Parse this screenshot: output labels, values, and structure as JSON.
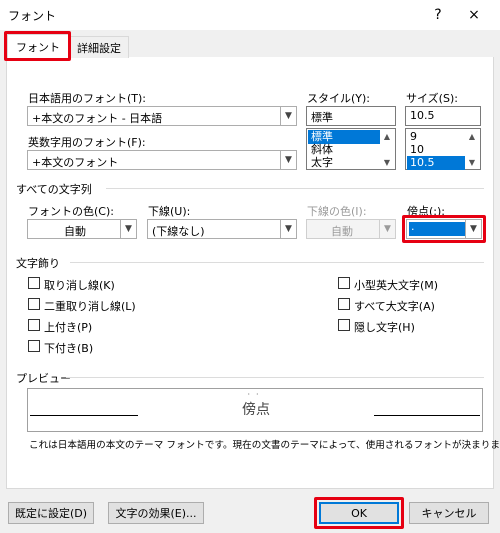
{
  "window": {
    "title": "フォント",
    "help": "?",
    "close": "×"
  },
  "tabs": [
    {
      "label": "フォント"
    },
    {
      "label": "詳細設定"
    }
  ],
  "font_section": {
    "ja_font_label": "日本語用のフォント(T):",
    "ja_font_value": "+本文のフォント - 日本語",
    "en_font_label": "英数字用のフォント(F):",
    "en_font_value": "+本文のフォント",
    "style_label": "スタイル(Y):",
    "style_value": "標準",
    "style_items": [
      "標準",
      "斜体",
      "太字"
    ],
    "size_label": "サイズ(S):",
    "size_value": "10.5",
    "size_items": [
      "9",
      "10",
      "10.5"
    ]
  },
  "all_text": {
    "section_title": "すべての文字列",
    "font_color_label": "フォントの色(C):",
    "font_color_value": "自動",
    "underline_label": "下線(U):",
    "underline_value": "(下線なし)",
    "underline_color_label": "下線の色(I):",
    "underline_color_value": "自動",
    "emphasis_label": "傍点(:):",
    "emphasis_value": "."
  },
  "effects": {
    "section_title": "文字飾り",
    "left": [
      "取り消し線(K)",
      "二重取り消し線(L)",
      "上付き(P)",
      "下付き(B)"
    ],
    "right": [
      "小型英大文字(M)",
      "すべて大文字(A)",
      "隠し文字(H)"
    ]
  },
  "preview": {
    "section_title": "プレビュー",
    "sample_text": "傍点",
    "description": "これは日本語用の本文のテーマ フォントです。現在の文書のテーマによって、使用されるフォントが決まります。"
  },
  "buttons": {
    "set_default": "既定に設定(D)",
    "text_effects": "文字の効果(E)...",
    "ok": "OK",
    "cancel": "キャンセル"
  },
  "colors": {
    "highlight": "#e60012",
    "selection": "#0078d7"
  }
}
